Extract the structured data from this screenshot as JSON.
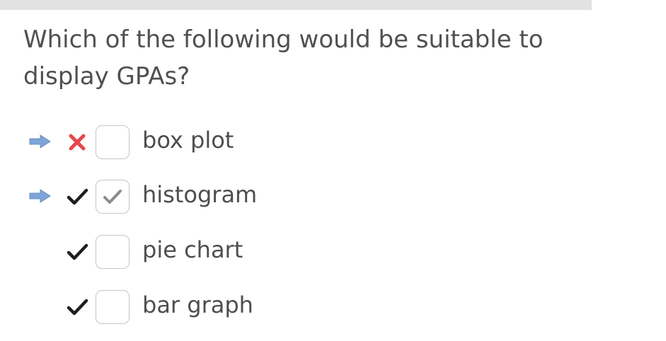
{
  "question": {
    "text": "Which of the following would be suitable to display GPAs?"
  },
  "options": [
    {
      "label": "box plot",
      "user_selected": false,
      "result_mark": "cross-icon",
      "answer_arrow": true
    },
    {
      "label": "histogram",
      "user_selected": true,
      "result_mark": "check-icon",
      "answer_arrow": true
    },
    {
      "label": "pie chart",
      "user_selected": false,
      "result_mark": "check-icon",
      "answer_arrow": false
    },
    {
      "label": "bar graph",
      "user_selected": false,
      "result_mark": "check-icon",
      "answer_arrow": false
    }
  ],
  "colors": {
    "arrow": "#7fa4d8",
    "cross": "#e8474c",
    "check": "#1e1e1e",
    "checkbox_border": "#c6c6c6",
    "checkbox_tick": "#8c8c8c",
    "text": "#4e4e4e"
  }
}
